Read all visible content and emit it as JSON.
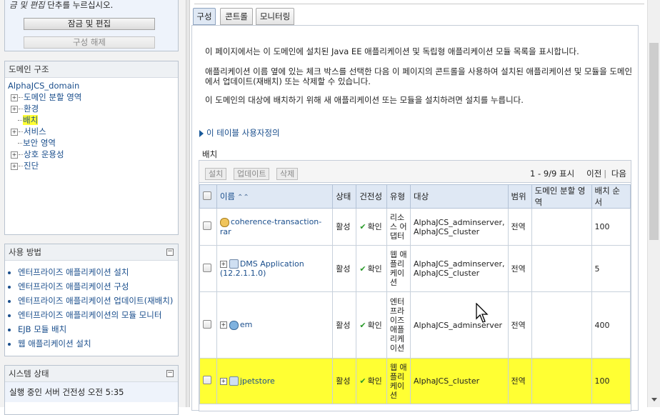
{
  "change_center": {
    "instruction_prefix": "금 및 편집",
    "instruction_suffix": " 단추를 누르십시오.",
    "lock_edit_label": "잠금 및 편집",
    "release_config_label": "구성 해제"
  },
  "domain_structure": {
    "title": "도메인 구조",
    "root": "AlphaJCS_domain",
    "items": [
      {
        "label": "도메인 분할 영역",
        "expandable": true
      },
      {
        "label": "환경",
        "expandable": true
      },
      {
        "label": "배치",
        "expandable": false,
        "highlighted": true
      },
      {
        "label": "서비스",
        "expandable": true
      },
      {
        "label": "보안 영역",
        "expandable": false
      },
      {
        "label": "상호 운용성",
        "expandable": true
      },
      {
        "label": "진단",
        "expandable": true
      }
    ]
  },
  "how_do_i": {
    "title": "사용 방법",
    "collapse": "⊟",
    "items": [
      "엔터프라이즈 애플리케이션 설치",
      "엔터프라이즈 애플리케이션 구성",
      "엔터프라이즈 애플리케이션 업데이트(재배치)",
      "엔터프라이즈 애플리케이션의 모듈 모니터",
      "EJB 모듈 배치",
      "웹 애플리케이션 설치"
    ]
  },
  "system_status": {
    "title": "시스템 상태",
    "collapse": "⊟",
    "text": "실행 중인 서버 건전성  오전 5:35"
  },
  "tabs": [
    {
      "label": "구성",
      "active": true
    },
    {
      "label": "콘트롤",
      "active": false
    },
    {
      "label": "모니터링",
      "active": false
    }
  ],
  "intro": {
    "p1": "이 페이지에서는 이 도메인에 설치된 Java EE 애플리케이션 및 독립형 애플리케이션 모듈 목록을 표시합니다.",
    "p2": "애플리케이션 이름 옆에 있는 체크 박스를 선택한 다음 이 페이지의 콘트롤을 사용하여 설치된 애플리케이션 및 모듈을 도메인에서 업데이트(재배치) 또는 삭제할 수 있습니다.",
    "p3": "이 도메인의 대상에 배치하기 위해 새 애플리케이션 또는 모듈을 설치하려면 설치를 누릅니다."
  },
  "customize_link": "이 테이블 사용자정의",
  "section_title": "배치",
  "toolbar": {
    "install": "설치",
    "update": "업데이트",
    "delete": "삭제",
    "pager_text": "1 - 9/9 표시",
    "prev": "이전",
    "next": "다음"
  },
  "table": {
    "headers": {
      "name": "이름",
      "state": "상태",
      "health": "건전성",
      "type": "유형",
      "targets": "대상",
      "scope": "범위",
      "partitions": "도메인 분할 영역",
      "order": "배치 순서"
    },
    "rows": [
      {
        "name": "coherence-transaction-rar",
        "expandable": false,
        "icon": "rar",
        "state": "활성",
        "health": "확인",
        "type": "리소스 어댑터",
        "targets": "AlphaJCS_adminserver, AlphaJCS_cluster",
        "scope": "전역",
        "partition": "",
        "order": "100"
      },
      {
        "name": "DMS Application (12.2.1.1.0)",
        "expandable": true,
        "icon": "war",
        "state": "활성",
        "health": "확인",
        "type": "웹 애플리케이션",
        "targets": "AlphaJCS_adminserver, AlphaJCS_cluster",
        "scope": "전역",
        "partition": "",
        "order": "5"
      },
      {
        "name": "em",
        "expandable": true,
        "icon": "ear",
        "state": "활성",
        "health": "확인",
        "type": "엔터프라이즈 애플리케이션",
        "targets": "AlphaJCS_adminserver",
        "scope": "전역",
        "partition": "",
        "order": "400"
      },
      {
        "name": "jpetstore",
        "expandable": true,
        "icon": "war",
        "highlighted": true,
        "state": "활성",
        "health": "확인",
        "type": "웹 애플리케이션",
        "targets": "AlphaJCS_cluster",
        "scope": "전역",
        "partition": "",
        "order": "100"
      }
    ]
  },
  "colors": {
    "highlight": "#ffff33",
    "link": "#1a4e8c",
    "header_bg": "#dfe8f4"
  }
}
